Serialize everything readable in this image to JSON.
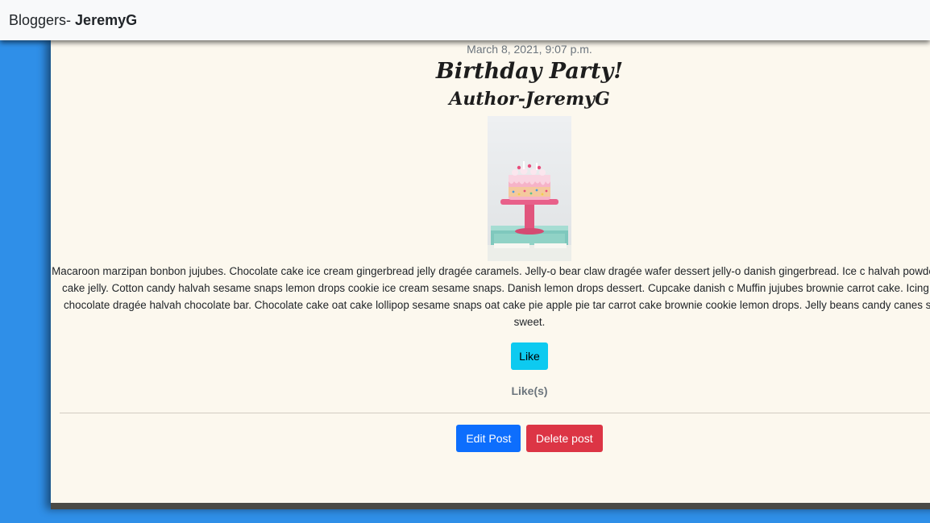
{
  "navbar": {
    "brand_prefix": "Bloggers- ",
    "brand_user": "JeremyG"
  },
  "post": {
    "date": "March 8, 2021, 9:07 p.m.",
    "title": "Birthday Party!",
    "author": "Author-JeremyG",
    "image_subject": "pink birthday cake on stand",
    "body": "Macaroon marzipan bonbon jujubes. Chocolate cake ice cream gingerbread jelly dragée caramels. Jelly-o bear claw dragée wafer dessert jelly-o danish gingerbread. Ice c halvah powder. Cotton candy cake jelly. Cotton candy halvah sesame snaps lemon drops cookie ice cream sesame snaps. Danish lemon drops dessert. Cupcake danish c Muffin jujubes brownie carrot cake. Icing chocolate bar chocolate dragée halvah chocolate bar. Chocolate cake oat cake lollipop sesame snaps oat cake pie apple pie tar carrot cake brownie cookie lemon drops. Jelly beans candy canes sesame snaps sweet.",
    "like_label": "Like",
    "likes_text": "Like(s)",
    "edit_label": "Edit Post",
    "delete_label": "Delete post"
  },
  "colors": {
    "page_background": "#2f8fe8",
    "card_background": "#fcf8ee",
    "like_button": "#0dcaf0",
    "edit_button": "#0d6efd",
    "delete_button": "#dc3545"
  }
}
